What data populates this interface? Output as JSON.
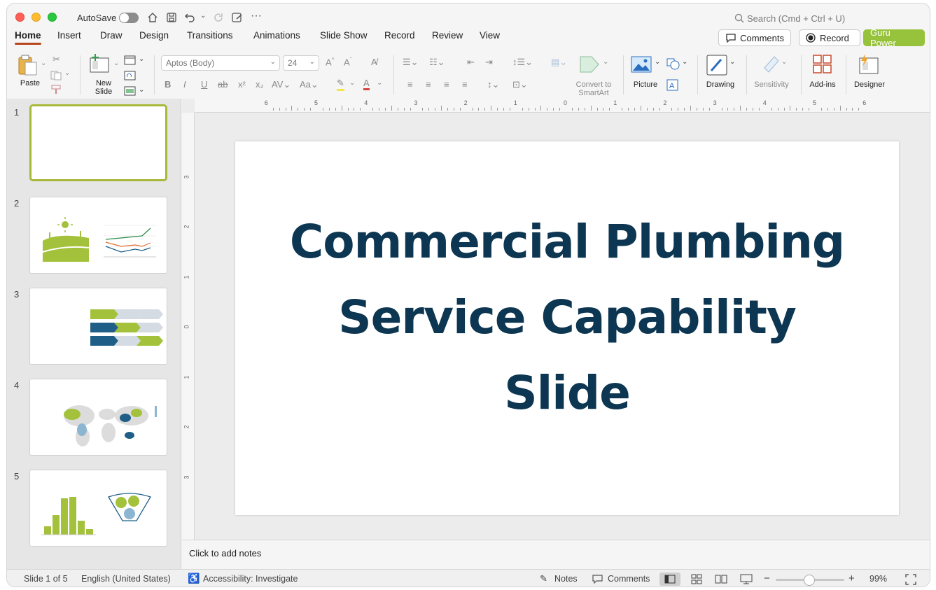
{
  "titlebar": {
    "autosave_label": "AutoSave",
    "search_placeholder": "Search (Cmd + Ctrl + U)",
    "more_icon": "···"
  },
  "tabs": [
    "Home",
    "Insert",
    "Draw",
    "Design",
    "Transitions",
    "Animations",
    "Slide Show",
    "Record",
    "Review",
    "View"
  ],
  "buttons": {
    "comments": "Comments",
    "record": "Record",
    "guru": "Guru Power"
  },
  "ribbon": {
    "paste": "Paste",
    "new_slide_1": "New",
    "new_slide_2": "Slide",
    "font_name": "Aptos (Body)",
    "font_size": "24",
    "convert_1": "Convert to",
    "convert_2": "SmartArt",
    "picture": "Picture",
    "drawing": "Drawing",
    "sensitivity": "Sensitivity",
    "addins": "Add-ins",
    "designer": "Designer"
  },
  "slides": [
    {
      "number": "1"
    },
    {
      "number": "2"
    },
    {
      "number": "3"
    },
    {
      "number": "4"
    },
    {
      "number": "5"
    }
  ],
  "slide": {
    "title_line1": "Commercial Plumbing",
    "title_line2": "Service Capability",
    "title_line3": "Slide"
  },
  "ruler": {
    "h": [
      "6",
      "5",
      "4",
      "3",
      "2",
      "1",
      "0",
      "1",
      "2",
      "3",
      "4",
      "5",
      "6"
    ],
    "v": [
      "3",
      "2",
      "1",
      "0",
      "1",
      "2",
      "3"
    ]
  },
  "notes": {
    "placeholder": "Click to add notes"
  },
  "status": {
    "slide_of": "Slide 1 of 5",
    "language": "English (United States)",
    "accessibility": "Accessibility: Investigate",
    "notes": "Notes",
    "comments": "Comments",
    "zoom": "99%"
  },
  "colors": {
    "accent": "#b7471b",
    "guru": "#97c23b",
    "title": "#0c3651",
    "lime": "#a3c13a",
    "navy": "#1f5f87"
  }
}
